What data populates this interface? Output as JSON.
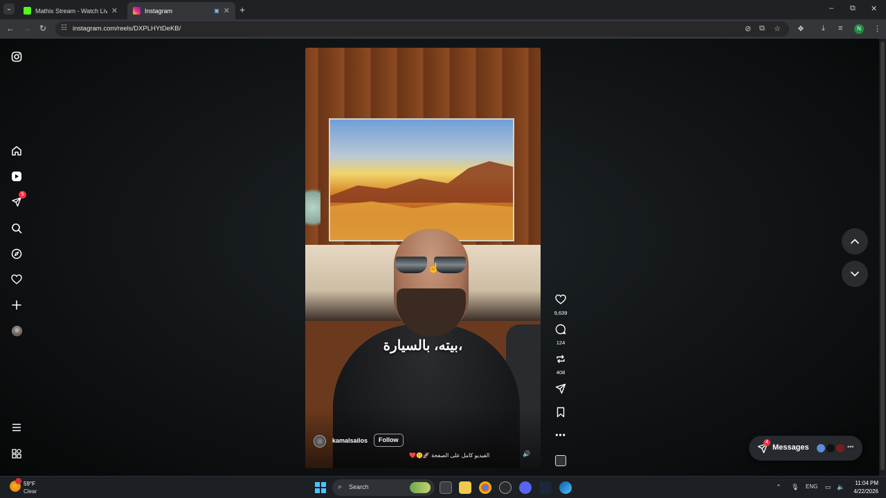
{
  "browser": {
    "tabs": [
      {
        "title": "Mathix Stream - Watch Live on",
        "favicon_color": "#53fc18",
        "active": false
      },
      {
        "title": "Instagram",
        "favicon_color": "#e1306c",
        "active": true
      }
    ],
    "new_tab": "+",
    "window_controls": {
      "minimize": "–",
      "restore": "⧉",
      "close": "✕"
    },
    "url": "instagram.com/reels/DXPLHYtDeKB/",
    "profile_initial": "N"
  },
  "sidebar": {
    "notifications_badge": "5",
    "items": [
      "instagram-logo",
      "home",
      "reels",
      "notifications",
      "search",
      "explore",
      "activity",
      "create",
      "profile",
      "more",
      "also-from-meta"
    ]
  },
  "reel": {
    "subtitle": "بيته، بالسيارة،",
    "author": "kamalsailos",
    "follow_label": "Follow",
    "caption": "الفيديو كامل على الصفحة 🚀🤫❤️"
  },
  "actions": {
    "likes": "9,639",
    "comments": "124",
    "reposts": "408"
  },
  "messages": {
    "label": "Messages",
    "badge": "4"
  },
  "taskbar": {
    "weather_temp": "59°F",
    "weather_condition": "Clear",
    "search_label": "Search",
    "language": "ENG",
    "time": "11:04 PM",
    "date": "4/22/2026"
  },
  "colors": {
    "accent": "#ff3040",
    "page_bg": "#0a0a0a",
    "tab_active": "#35363a"
  }
}
